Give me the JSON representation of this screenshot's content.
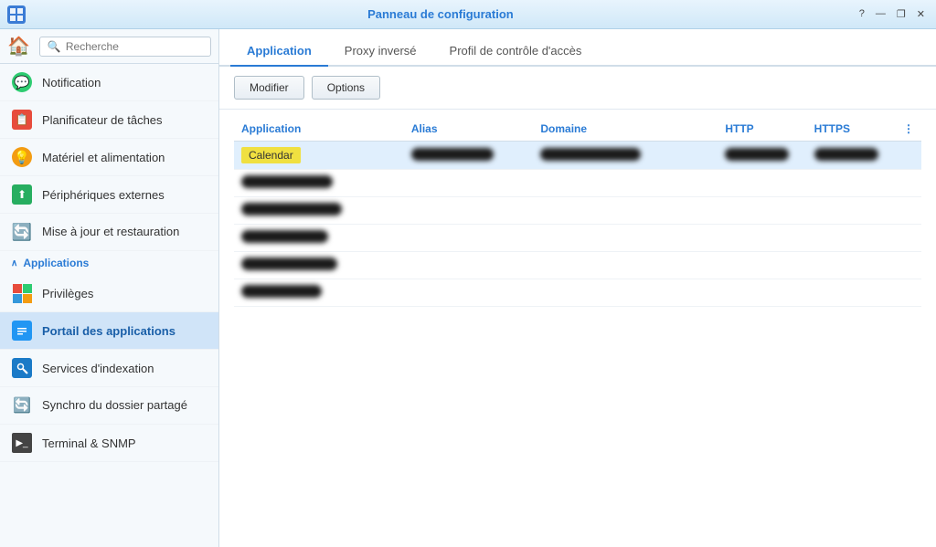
{
  "titlebar": {
    "title": "Panneau de configuration",
    "icon": "⊞",
    "controls": {
      "minimize": "—",
      "maximize": "❐",
      "close": "✕",
      "question": "?"
    }
  },
  "sidebar": {
    "search_placeholder": "Recherche",
    "items": [
      {
        "id": "notification",
        "label": "Notification",
        "icon": "💬"
      },
      {
        "id": "planificateur",
        "label": "Planificateur de tâches",
        "icon": "📅"
      },
      {
        "id": "materiel",
        "label": "Matériel et alimentation",
        "icon": "💡"
      },
      {
        "id": "peripheriques",
        "label": "Périphériques externes",
        "icon": "🔌"
      },
      {
        "id": "miseajour",
        "label": "Mise à jour et restauration",
        "icon": "🔄"
      }
    ],
    "section_applications": {
      "label": "Applications",
      "chevron": "∧",
      "items": [
        {
          "id": "privileges",
          "label": "Privilèges"
        },
        {
          "id": "portail",
          "label": "Portail des applications",
          "active": true
        },
        {
          "id": "indexation",
          "label": "Services d'indexation"
        },
        {
          "id": "synchro",
          "label": "Synchro du dossier partagé"
        },
        {
          "id": "terminal",
          "label": "Terminal & SNMP"
        }
      ]
    }
  },
  "tabs": [
    {
      "id": "application",
      "label": "Application",
      "active": true
    },
    {
      "id": "proxy",
      "label": "Proxy inversé"
    },
    {
      "id": "profil",
      "label": "Profil de contrôle d'accès"
    }
  ],
  "toolbar": {
    "modifier_label": "Modifier",
    "options_label": "Options"
  },
  "table": {
    "columns": [
      {
        "id": "application",
        "label": "Application"
      },
      {
        "id": "alias",
        "label": "Alias"
      },
      {
        "id": "domaine",
        "label": "Domaine"
      },
      {
        "id": "http",
        "label": "HTTP"
      },
      {
        "id": "https",
        "label": "HTTPS"
      }
    ],
    "rows": [
      {
        "id": "row1",
        "application": "Calendar",
        "selected": true
      },
      {
        "id": "row2"
      },
      {
        "id": "row3"
      },
      {
        "id": "row4"
      },
      {
        "id": "row5"
      },
      {
        "id": "row6"
      }
    ]
  }
}
